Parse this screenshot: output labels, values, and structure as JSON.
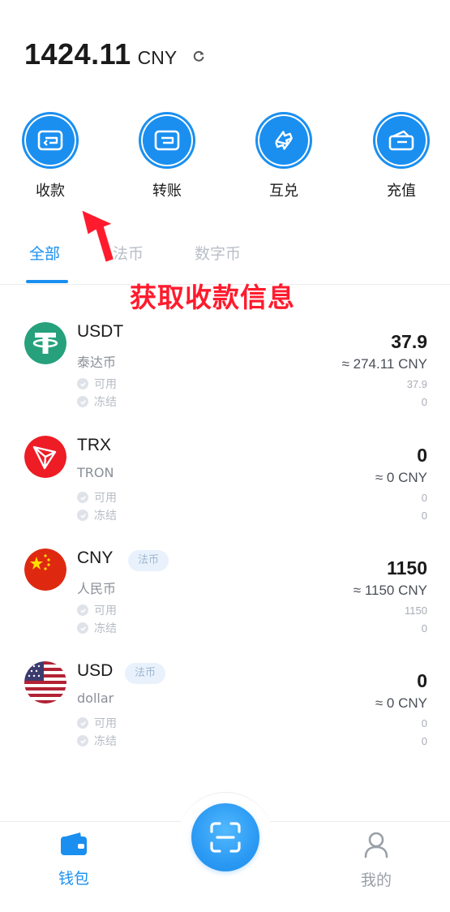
{
  "balance": {
    "amount": "1424.11",
    "currency": "CNY"
  },
  "actions": [
    {
      "label": "收款",
      "icon": "receive-icon"
    },
    {
      "label": "转账",
      "icon": "transfer-icon"
    },
    {
      "label": "互兑",
      "icon": "exchange-icon"
    },
    {
      "label": "充值",
      "icon": "recharge-icon"
    }
  ],
  "annotation": "获取收款信息",
  "tabs": [
    {
      "label": "全部",
      "active": true
    },
    {
      "label": "法币",
      "active": false
    },
    {
      "label": "数字币",
      "active": false
    }
  ],
  "assets": [
    {
      "symbol": "USDT",
      "tag": "",
      "subtitle": "泰达币",
      "available_label": "可用",
      "frozen_label": "冻结",
      "amount": "37.9",
      "approx": "≈ 274.11 CNY",
      "available": "37.9",
      "frozen": "0",
      "logo": "tether-icon"
    },
    {
      "symbol": "TRX",
      "tag": "",
      "subtitle": "TRON",
      "available_label": "可用",
      "frozen_label": "冻结",
      "amount": "0",
      "approx": "≈ 0 CNY",
      "available": "0",
      "frozen": "0",
      "logo": "tron-icon"
    },
    {
      "symbol": "CNY",
      "tag": "法币",
      "subtitle": "人民币",
      "available_label": "可用",
      "frozen_label": "冻结",
      "amount": "1150",
      "approx": "≈ 1150 CNY",
      "available": "1150",
      "frozen": "0",
      "logo": "china-flag-icon"
    },
    {
      "symbol": "USD",
      "tag": "法币",
      "subtitle": "dollar",
      "available_label": "可用",
      "frozen_label": "冻结",
      "amount": "0",
      "approx": "≈ 0 CNY",
      "available": "0",
      "frozen": "0",
      "logo": "us-flag-icon"
    }
  ],
  "nav": {
    "wallet_label": "钱包",
    "mine_label": "我的",
    "active_color": "#1a8ff0",
    "inactive_color": "#9aa0a8"
  }
}
